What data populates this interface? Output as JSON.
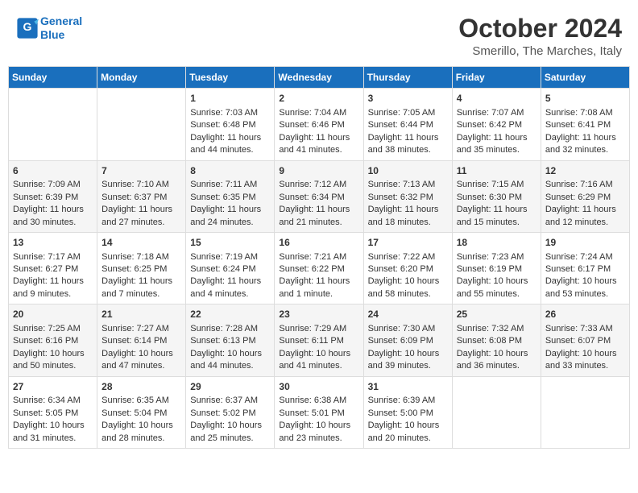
{
  "header": {
    "logo_line1": "General",
    "logo_line2": "Blue",
    "month_title": "October 2024",
    "location": "Smerillo, The Marches, Italy"
  },
  "days_of_week": [
    "Sunday",
    "Monday",
    "Tuesday",
    "Wednesday",
    "Thursday",
    "Friday",
    "Saturday"
  ],
  "weeks": [
    [
      {
        "day": "",
        "info": ""
      },
      {
        "day": "",
        "info": ""
      },
      {
        "day": "1",
        "info": "Sunrise: 7:03 AM\nSunset: 6:48 PM\nDaylight: 11 hours and 44 minutes."
      },
      {
        "day": "2",
        "info": "Sunrise: 7:04 AM\nSunset: 6:46 PM\nDaylight: 11 hours and 41 minutes."
      },
      {
        "day": "3",
        "info": "Sunrise: 7:05 AM\nSunset: 6:44 PM\nDaylight: 11 hours and 38 minutes."
      },
      {
        "day": "4",
        "info": "Sunrise: 7:07 AM\nSunset: 6:42 PM\nDaylight: 11 hours and 35 minutes."
      },
      {
        "day": "5",
        "info": "Sunrise: 7:08 AM\nSunset: 6:41 PM\nDaylight: 11 hours and 32 minutes."
      }
    ],
    [
      {
        "day": "6",
        "info": "Sunrise: 7:09 AM\nSunset: 6:39 PM\nDaylight: 11 hours and 30 minutes."
      },
      {
        "day": "7",
        "info": "Sunrise: 7:10 AM\nSunset: 6:37 PM\nDaylight: 11 hours and 27 minutes."
      },
      {
        "day": "8",
        "info": "Sunrise: 7:11 AM\nSunset: 6:35 PM\nDaylight: 11 hours and 24 minutes."
      },
      {
        "day": "9",
        "info": "Sunrise: 7:12 AM\nSunset: 6:34 PM\nDaylight: 11 hours and 21 minutes."
      },
      {
        "day": "10",
        "info": "Sunrise: 7:13 AM\nSunset: 6:32 PM\nDaylight: 11 hours and 18 minutes."
      },
      {
        "day": "11",
        "info": "Sunrise: 7:15 AM\nSunset: 6:30 PM\nDaylight: 11 hours and 15 minutes."
      },
      {
        "day": "12",
        "info": "Sunrise: 7:16 AM\nSunset: 6:29 PM\nDaylight: 11 hours and 12 minutes."
      }
    ],
    [
      {
        "day": "13",
        "info": "Sunrise: 7:17 AM\nSunset: 6:27 PM\nDaylight: 11 hours and 9 minutes."
      },
      {
        "day": "14",
        "info": "Sunrise: 7:18 AM\nSunset: 6:25 PM\nDaylight: 11 hours and 7 minutes."
      },
      {
        "day": "15",
        "info": "Sunrise: 7:19 AM\nSunset: 6:24 PM\nDaylight: 11 hours and 4 minutes."
      },
      {
        "day": "16",
        "info": "Sunrise: 7:21 AM\nSunset: 6:22 PM\nDaylight: 11 hours and 1 minute."
      },
      {
        "day": "17",
        "info": "Sunrise: 7:22 AM\nSunset: 6:20 PM\nDaylight: 10 hours and 58 minutes."
      },
      {
        "day": "18",
        "info": "Sunrise: 7:23 AM\nSunset: 6:19 PM\nDaylight: 10 hours and 55 minutes."
      },
      {
        "day": "19",
        "info": "Sunrise: 7:24 AM\nSunset: 6:17 PM\nDaylight: 10 hours and 53 minutes."
      }
    ],
    [
      {
        "day": "20",
        "info": "Sunrise: 7:25 AM\nSunset: 6:16 PM\nDaylight: 10 hours and 50 minutes."
      },
      {
        "day": "21",
        "info": "Sunrise: 7:27 AM\nSunset: 6:14 PM\nDaylight: 10 hours and 47 minutes."
      },
      {
        "day": "22",
        "info": "Sunrise: 7:28 AM\nSunset: 6:13 PM\nDaylight: 10 hours and 44 minutes."
      },
      {
        "day": "23",
        "info": "Sunrise: 7:29 AM\nSunset: 6:11 PM\nDaylight: 10 hours and 41 minutes."
      },
      {
        "day": "24",
        "info": "Sunrise: 7:30 AM\nSunset: 6:09 PM\nDaylight: 10 hours and 39 minutes."
      },
      {
        "day": "25",
        "info": "Sunrise: 7:32 AM\nSunset: 6:08 PM\nDaylight: 10 hours and 36 minutes."
      },
      {
        "day": "26",
        "info": "Sunrise: 7:33 AM\nSunset: 6:07 PM\nDaylight: 10 hours and 33 minutes."
      }
    ],
    [
      {
        "day": "27",
        "info": "Sunrise: 6:34 AM\nSunset: 5:05 PM\nDaylight: 10 hours and 31 minutes."
      },
      {
        "day": "28",
        "info": "Sunrise: 6:35 AM\nSunset: 5:04 PM\nDaylight: 10 hours and 28 minutes."
      },
      {
        "day": "29",
        "info": "Sunrise: 6:37 AM\nSunset: 5:02 PM\nDaylight: 10 hours and 25 minutes."
      },
      {
        "day": "30",
        "info": "Sunrise: 6:38 AM\nSunset: 5:01 PM\nDaylight: 10 hours and 23 minutes."
      },
      {
        "day": "31",
        "info": "Sunrise: 6:39 AM\nSunset: 5:00 PM\nDaylight: 10 hours and 20 minutes."
      },
      {
        "day": "",
        "info": ""
      },
      {
        "day": "",
        "info": ""
      }
    ]
  ]
}
